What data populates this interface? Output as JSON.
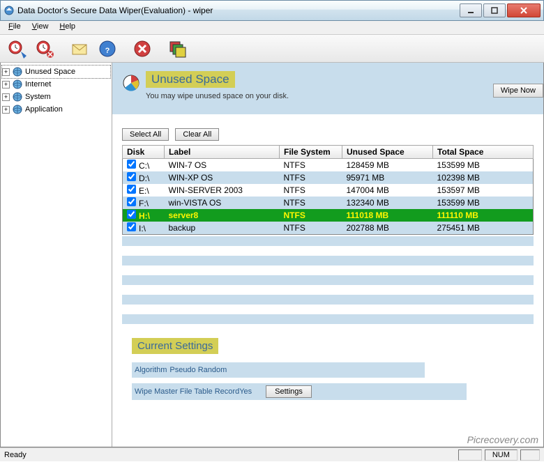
{
  "window": {
    "title": "Data Doctor's Secure Data Wiper(Evaluation) - wiper"
  },
  "menu": {
    "file": "File",
    "view": "View",
    "help": "Help"
  },
  "tree": {
    "items": [
      {
        "label": "Unused Space",
        "selected": true
      },
      {
        "label": "Internet"
      },
      {
        "label": "System"
      },
      {
        "label": "Application"
      }
    ]
  },
  "page": {
    "title": "Unused Space",
    "subtitle": "You may wipe unused space on your disk.",
    "wipe_btn": "Wipe Now",
    "select_all": "Select All",
    "clear_all": "Clear All"
  },
  "table": {
    "headers": {
      "disk": "Disk",
      "label": "Label",
      "fs": "File System",
      "unused": "Unused Space",
      "total": "Total Space"
    },
    "rows": [
      {
        "disk": "C:\\",
        "label": "WIN-7 OS",
        "fs": "NTFS",
        "unused": "128459 MB",
        "total": "153599 MB",
        "checked": true
      },
      {
        "disk": "D:\\",
        "label": "WIN-XP OS",
        "fs": "NTFS",
        "unused": "95971 MB",
        "total": "102398 MB",
        "checked": true
      },
      {
        "disk": "E:\\",
        "label": "WIN-SERVER 2003",
        "fs": "NTFS",
        "unused": "147004 MB",
        "total": "153597 MB",
        "checked": true
      },
      {
        "disk": "F:\\",
        "label": "win-VISTA OS",
        "fs": "NTFS",
        "unused": "132340 MB",
        "total": "153599 MB",
        "checked": true
      },
      {
        "disk": "H:\\",
        "label": "server8",
        "fs": "NTFS",
        "unused": "111018 MB",
        "total": "111110 MB",
        "checked": true,
        "selected": true
      },
      {
        "disk": "I:\\",
        "label": "backup",
        "fs": "NTFS",
        "unused": "202788 MB",
        "total": "275451 MB",
        "checked": true
      }
    ]
  },
  "settings": {
    "title": "Current Settings",
    "algo_label": "Algorithm",
    "algo_value": "Pseudo Random",
    "mft_label": "Wipe Master File Table Record",
    "mft_value": "Yes",
    "btn": "Settings"
  },
  "status": {
    "ready": "Ready",
    "num": "NUM"
  },
  "watermark": "Picrecovery.com"
}
